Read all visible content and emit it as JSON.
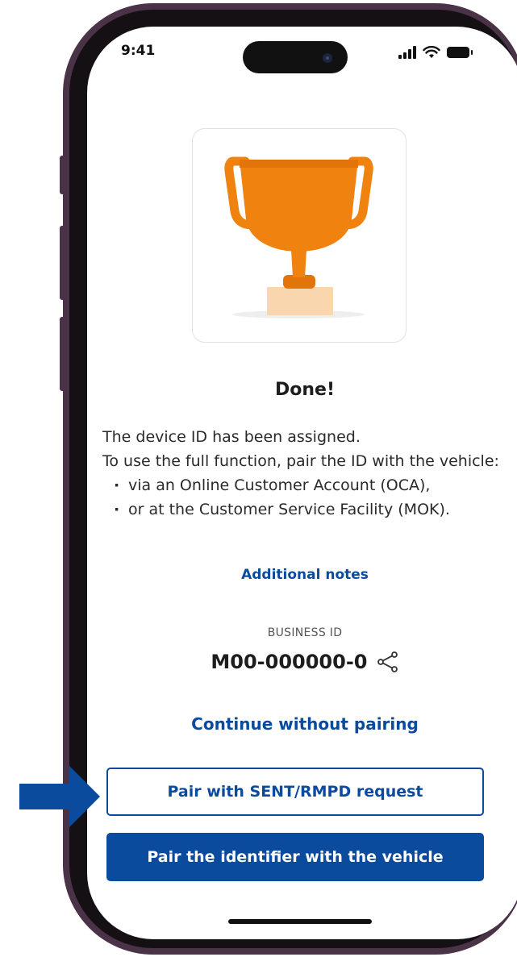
{
  "status_bar": {
    "time": "9:41"
  },
  "screen": {
    "title": "Done!",
    "body_lines": [
      "The device ID has been assigned.",
      "To use the full function, pair the ID with the vehicle:"
    ],
    "bullets": [
      "via an Online Customer Account (OCA),",
      "or at the Customer Service Facility (MOK)."
    ],
    "additional_notes_link": "Additional notes",
    "business_id_label": "BUSINESS ID",
    "business_id_value": "M00-000000-0",
    "continue_link": "Continue without pairing",
    "pair_sent_button": "Pair with SENT/RMPD request",
    "pair_vehicle_button": "Pair the identifier with the vehicle"
  },
  "colors": {
    "brand_blue": "#0a4b9e",
    "trophy_orange": "#f0820f",
    "phone_frame": "#4a3247"
  },
  "icons": [
    "trophy-icon",
    "share-icon",
    "signal-icon",
    "wifi-icon",
    "battery-icon",
    "pointer-arrow-icon"
  ]
}
